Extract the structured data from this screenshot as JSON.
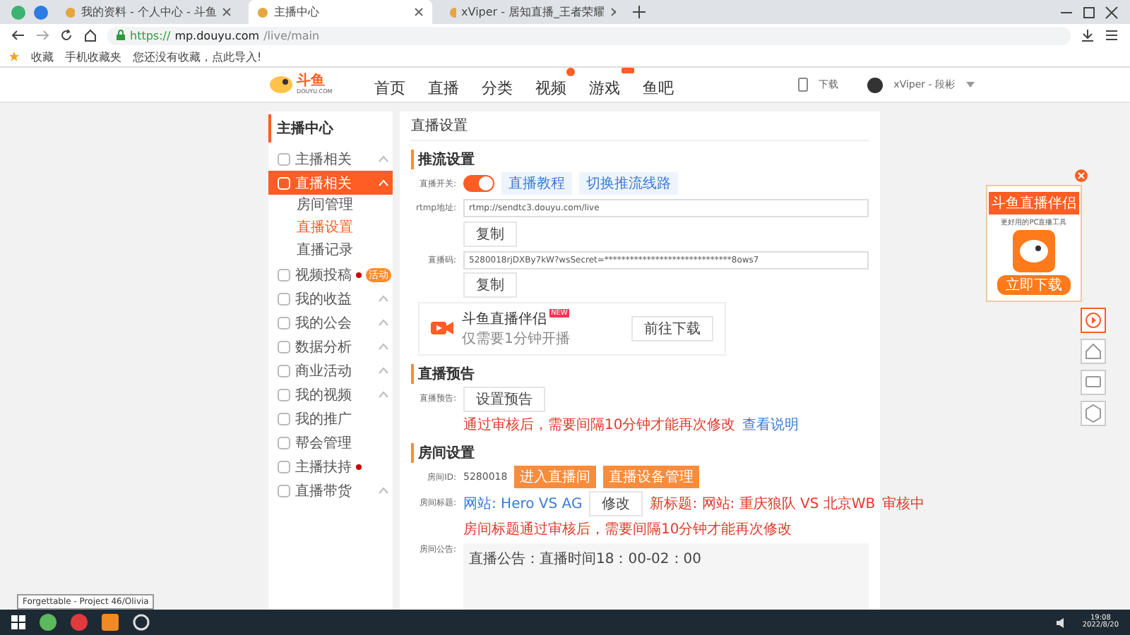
{
  "browser": {
    "tabs": [
      {
        "title": "我的资料 - 个人中心 - 斗鱼",
        "selected": false
      },
      {
        "title": "主播中心",
        "selected": true
      },
      {
        "title": "xViper - 居知直播_王者荣耀",
        "selected": false
      }
    ],
    "url_scheme": "https://",
    "url_host": "mp.douyu.com",
    "url_path": "/live/main",
    "bookmarks": [
      "收藏",
      "手机收藏夹",
      "您还没有收藏，点此导入!"
    ]
  },
  "site_header": {
    "logo": "斗鱼",
    "logo_sub": "DOUYU.COM",
    "nav": [
      {
        "label": "首页"
      },
      {
        "label": "直播"
      },
      {
        "label": "分类"
      },
      {
        "label": "视频",
        "dot": true
      },
      {
        "label": "游戏",
        "hot": true
      },
      {
        "label": "鱼吧"
      }
    ],
    "download": "下载",
    "user": "xViper - 段彬"
  },
  "sidebar": {
    "title": "主播中心",
    "items": [
      {
        "label": "主播相关",
        "kind": "group",
        "selected": false
      },
      {
        "label": "直播相关",
        "kind": "group",
        "selected": true,
        "children": [
          {
            "label": "房间管理",
            "selected": false
          },
          {
            "label": "直播设置",
            "selected": true
          },
          {
            "label": "直播记录",
            "selected": false
          }
        ]
      },
      {
        "label": "视频投稿",
        "kind": "link",
        "selected": false,
        "dot": true,
        "badge": "活动"
      },
      {
        "label": "我的收益",
        "kind": "group",
        "selected": false
      },
      {
        "label": "我的公会",
        "kind": "group",
        "selected": false
      },
      {
        "label": "数据分析",
        "kind": "group",
        "selected": false
      },
      {
        "label": "商业活动",
        "kind": "group",
        "selected": false
      },
      {
        "label": "我的视频",
        "kind": "group",
        "selected": false
      },
      {
        "label": "我的推广",
        "kind": "link",
        "selected": false
      },
      {
        "label": "帮会管理",
        "kind": "link",
        "selected": false
      },
      {
        "label": "主播扶持",
        "kind": "link",
        "selected": false,
        "dot": true
      },
      {
        "label": "直播带货",
        "kind": "group",
        "selected": false
      }
    ]
  },
  "page_title": "直播设置",
  "stream": {
    "heading": "推流设置",
    "switch_label": "直播开关:",
    "switch_on": true,
    "links": [
      "直播教程",
      "切换推流线路"
    ],
    "rtmp_label": "rtmp地址:",
    "rtmp_value": "rtmp://sendtc3.douyu.com/live",
    "copy_1": "复制",
    "code_label": "直播码:",
    "code_value": "5280018rjDXBy7kW?wsSecret=******************************8ows7",
    "copy_2": "复制",
    "promo_title": "斗鱼直播伴侣",
    "promo_badge": "NEW",
    "promo_sub": "仅需要1分钟开播",
    "promo_button": "前往下载"
  },
  "preview": {
    "heading": "直播预告",
    "label": "直播预告:",
    "button": "设置预告",
    "note": "通过审核后，需要间隔10分钟才能再次修改",
    "link": "查看说明"
  },
  "room": {
    "heading": "房间设置",
    "id_label": "房间ID:",
    "id": "5280018",
    "buttons": [
      "进入直播间",
      "直播设备管理"
    ],
    "title_label": "房间标题:",
    "title_value": "网站: Hero VS AG",
    "edit": "修改",
    "new_title": "新标题: 网站: 重庆狼队 VS 北京WB",
    "status": "审核中",
    "title_note": "房间标题通过审核后，需要间隔10分钟才能再次修改",
    "notice_label": "房间公告:",
    "notice_value": "直播公告：直播时间18：00-02：00"
  },
  "ad": {
    "title": "斗鱼直播伴侣",
    "subtitle": "更好用的PC直播工具",
    "button": "立即下载"
  },
  "tooltip": "Forgettable - Project 46/Olivia",
  "taskbar": {
    "time": "19:08",
    "date": "2022/8/20"
  }
}
